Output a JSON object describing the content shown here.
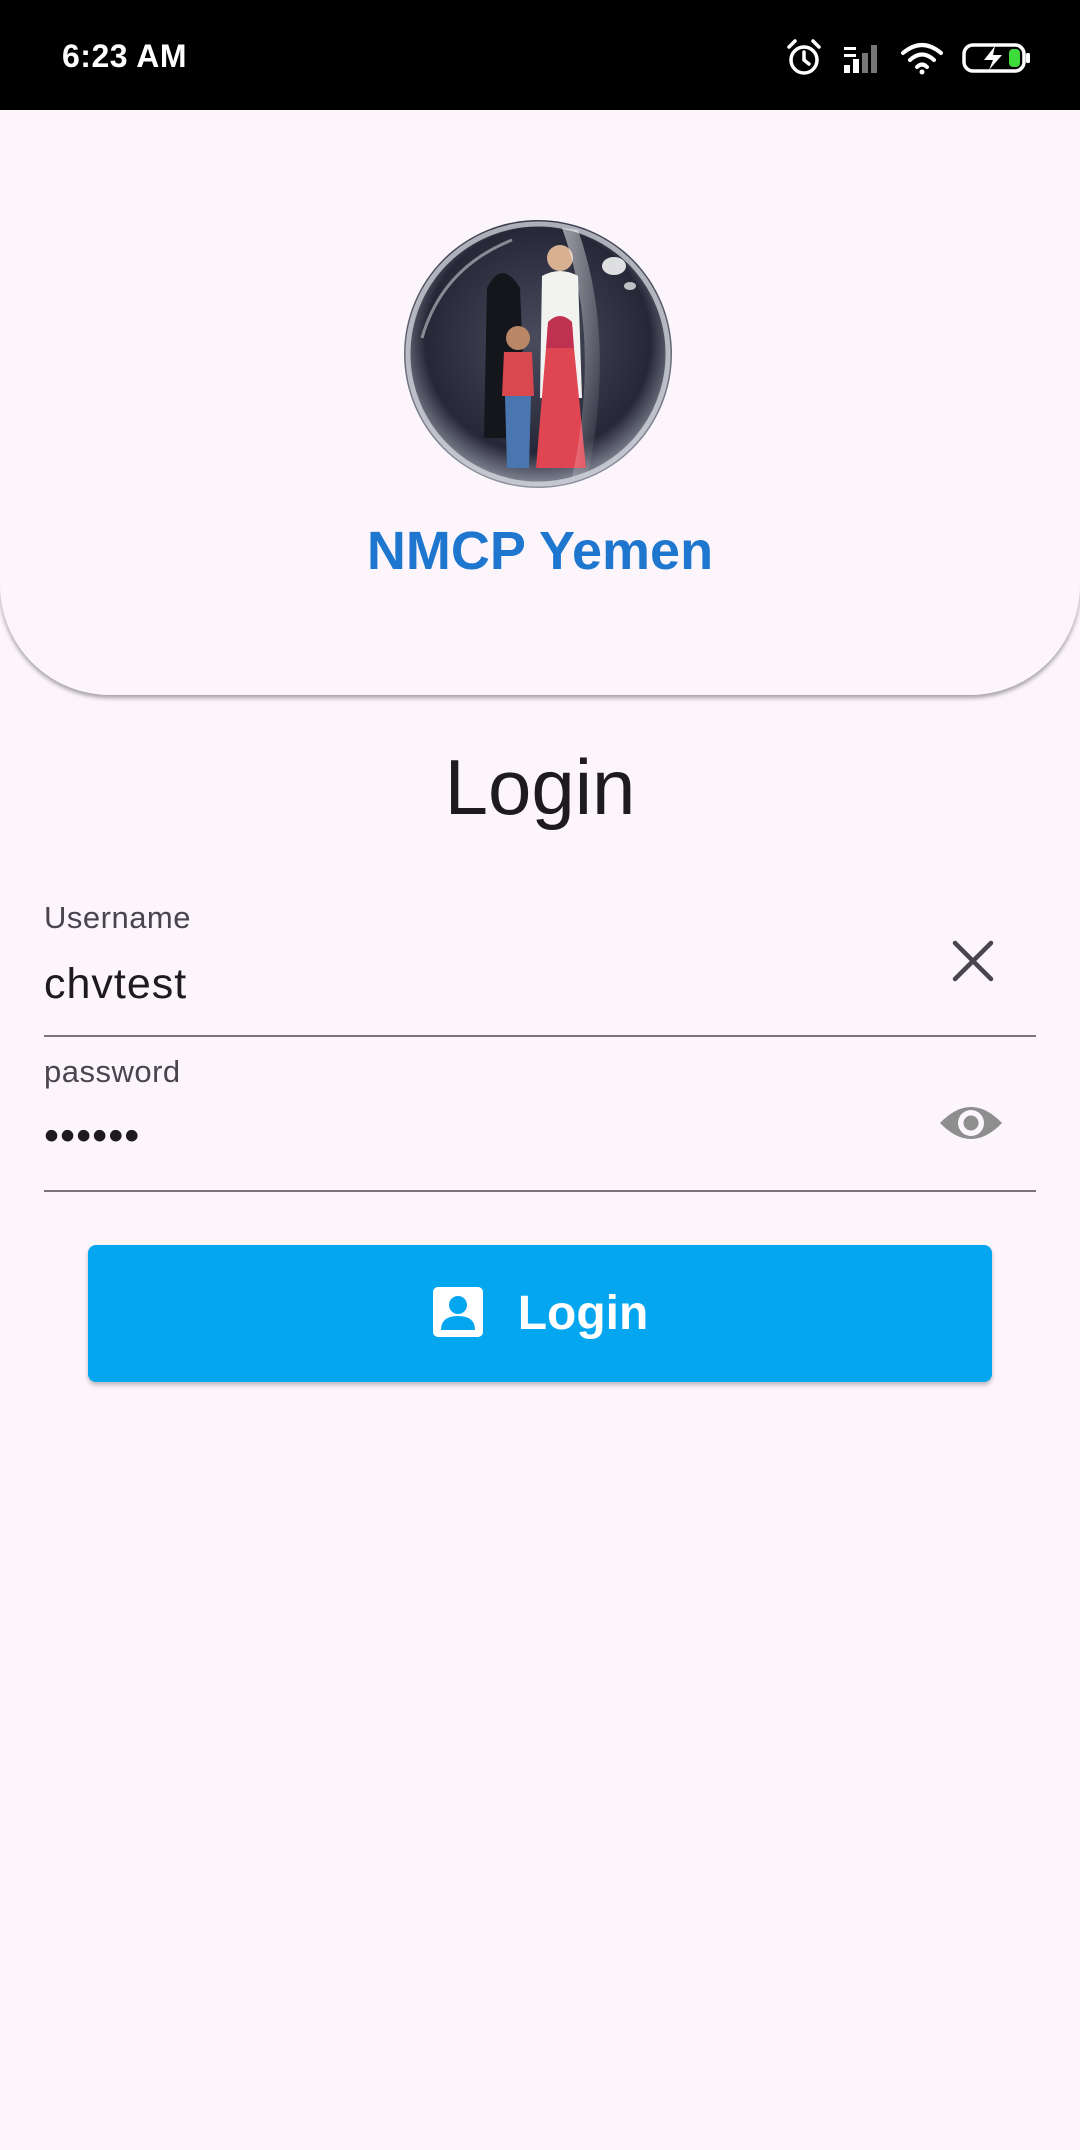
{
  "status_bar": {
    "time": "6:23 AM",
    "icons": [
      "alarm-icon",
      "signal-icon",
      "wifi-icon",
      "battery-charging-icon"
    ]
  },
  "header": {
    "logo": "family-globe-logo",
    "app_name": "NMCP Yemen"
  },
  "form": {
    "title": "Login",
    "username": {
      "label": "Username",
      "value": "chvtest",
      "trailing_icon": "clear-icon"
    },
    "password": {
      "label": "password",
      "value": "••••••",
      "trailing_icon": "visibility-icon"
    },
    "submit": {
      "label": "Login",
      "icon": "account-box-icon"
    }
  },
  "colors": {
    "background": "#fcf6fc",
    "accent_title": "#1e76cf",
    "button": "#03a6ef",
    "status_bar": "#000000"
  }
}
